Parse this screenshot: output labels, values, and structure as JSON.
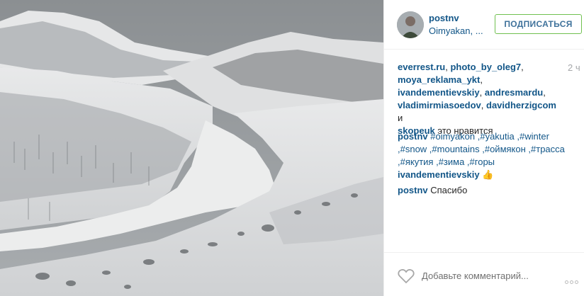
{
  "post": {
    "username": "postnv",
    "location": "Oimyakan, ...",
    "follow_label": "ПОДПИСАТЬСЯ",
    "time": "2 ч"
  },
  "likes": {
    "users": [
      "everrest.ru",
      "photo_by_oleg7",
      "moya_reklama_ykt",
      "ivandementievskiy",
      "andresmardu",
      "vladimirmiasoedov",
      "davidherzigcom",
      "skopeuk"
    ],
    "and_word": "и",
    "suffix": "это нравится"
  },
  "comments": [
    {
      "user": "postnv",
      "text": "#oimyakon ,#yakutia ,#winter ,#snow ,#mountains ,#оймякон ,#трасса ,#якутия ,#зима ,#горы"
    },
    {
      "user": "ivandementievskiy",
      "text": "👍"
    },
    {
      "user": "postnv",
      "text": "Спасибо"
    }
  ],
  "add_comment_placeholder": "Добавьте комментарий...",
  "icons": {
    "like": "heart-icon",
    "more": "more-options-icon"
  },
  "colors": {
    "link": "#125688",
    "follow_border": "#70c050",
    "follow_text": "#3f729b",
    "meta": "#a5a7aa"
  }
}
